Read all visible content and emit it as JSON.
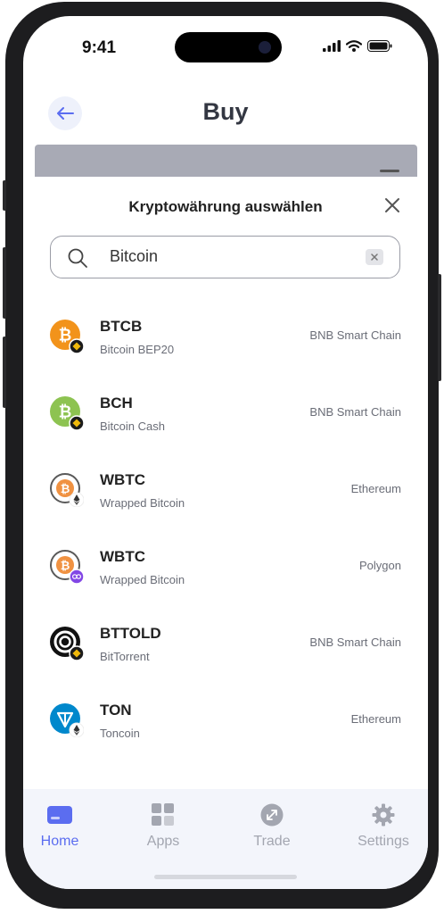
{
  "status_bar": {
    "time": "9:41"
  },
  "header": {
    "title": "Buy"
  },
  "sheet": {
    "title": "Kryptowährung auswählen",
    "search": {
      "value": "Bitcoin"
    }
  },
  "tokens": [
    {
      "symbol": "BTCB",
      "name": "Bitcoin BEP20",
      "chain": "BNB Smart Chain",
      "icon": "bitcoin-bnb-icon"
    },
    {
      "symbol": "BCH",
      "name": "Bitcoin Cash",
      "chain": "BNB Smart Chain",
      "icon": "bitcoin-cash-bnb-icon"
    },
    {
      "symbol": "WBTC",
      "name": "Wrapped Bitcoin",
      "chain": "Ethereum",
      "icon": "wrapped-bitcoin-ethereum-icon"
    },
    {
      "symbol": "WBTC",
      "name": "Wrapped Bitcoin",
      "chain": "Polygon",
      "icon": "wrapped-bitcoin-polygon-icon"
    },
    {
      "symbol": "BTTOLD",
      "name": "BitTorrent",
      "chain": "BNB Smart Chain",
      "icon": "bittorrent-bnb-icon"
    },
    {
      "symbol": "TON",
      "name": "Toncoin",
      "chain": "Ethereum",
      "icon": "toncoin-ethereum-icon"
    }
  ],
  "tabbar": {
    "items": [
      {
        "label": "Home",
        "icon": "home-card-icon",
        "active": true
      },
      {
        "label": "Apps",
        "icon": "apps-grid-icon",
        "active": false
      },
      {
        "label": "Trade",
        "icon": "trade-icon",
        "active": false
      },
      {
        "label": "Settings",
        "icon": "gear-icon",
        "active": false
      }
    ]
  },
  "colors": {
    "accent": "#5b6df0",
    "bitcoin_orange": "#f2931b",
    "bch_green": "#8dc351",
    "polygon_purple": "#8247e5",
    "toncoin_blue": "#0088cc",
    "bnb_gold": "#f0b90b",
    "inactive_tab": "#a3a6b0"
  }
}
